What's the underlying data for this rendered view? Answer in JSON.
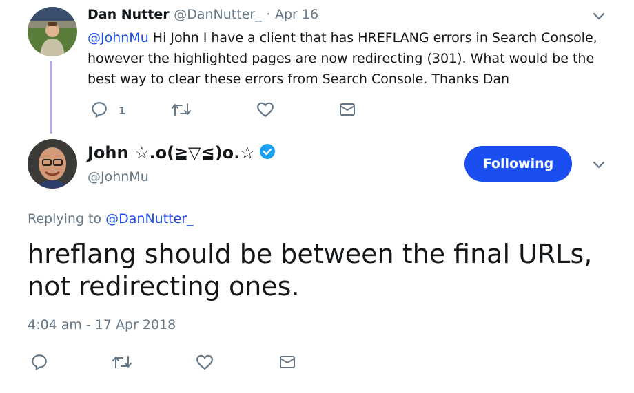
{
  "tweet1": {
    "author_name": "Dan Nutter",
    "author_handle": "@DanNutter_",
    "separator": "·",
    "date": "Apr 16",
    "mention": "@JohnMu",
    "text": " Hi John I have a client that has HREFLANG errors in Search Console, however the highlighted pages are now redirecting (301). What would be the best way to clear these errors from Search Console. Thanks Dan",
    "reply_count": "1",
    "icons": [
      "reply-icon",
      "retweet-icon",
      "like-icon",
      "dm-icon",
      "chevron-down-icon"
    ]
  },
  "tweet2": {
    "author_name": "John ☆.o(≧▽≦)o.☆",
    "author_handle": "@JohnMu",
    "follow_label": "Following",
    "replying_prefix": "Replying to ",
    "replying_to": "@DanNutter_",
    "text": "hreflang should be between the final URLs, not redirecting ones.",
    "timestamp": "4:04 am - 17 Apr 2018",
    "icons": [
      "verified-badge-icon",
      "reply-icon",
      "retweet-icon",
      "like-icon",
      "dm-icon",
      "chevron-down-icon"
    ]
  },
  "colors": {
    "accent": "#1a4ef0",
    "link": "#1b4ee6",
    "muted": "#657786",
    "verified": "#1da1f2",
    "thread_line": "#b8a8e8"
  }
}
